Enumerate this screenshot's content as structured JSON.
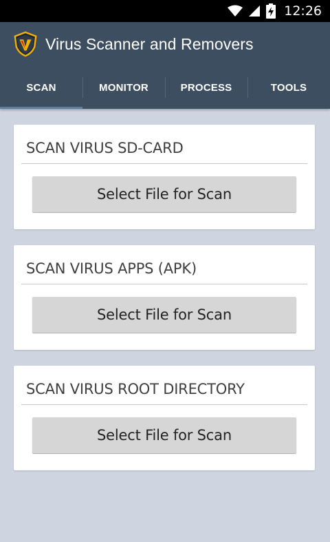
{
  "status_bar": {
    "time": "12:26",
    "icons": [
      "wifi-icon",
      "signal-icon",
      "battery-charging-icon"
    ]
  },
  "app_bar": {
    "title": "Virus Scanner and Removers",
    "logo_icon": "shield-v-icon"
  },
  "tabs": [
    {
      "label": "SCAN",
      "selected": true
    },
    {
      "label": "MONITOR",
      "selected": false
    },
    {
      "label": "PROCESS",
      "selected": false
    },
    {
      "label": "TOOLS",
      "selected": false
    }
  ],
  "cards": [
    {
      "heading": "SCAN VIRUS SD-CARD",
      "button_label": "Select File for Scan"
    },
    {
      "heading": "SCAN VIRUS APPS (APK)",
      "button_label": "Select File for Scan"
    },
    {
      "heading": "SCAN VIRUS ROOT DIRECTORY",
      "button_label": "Select File for Scan"
    }
  ],
  "colors": {
    "app_bar": "#3e4e61",
    "background": "#cfd5e0",
    "card": "#ffffff",
    "button": "#d6d6d6",
    "logo_accent": "#f5b100"
  }
}
